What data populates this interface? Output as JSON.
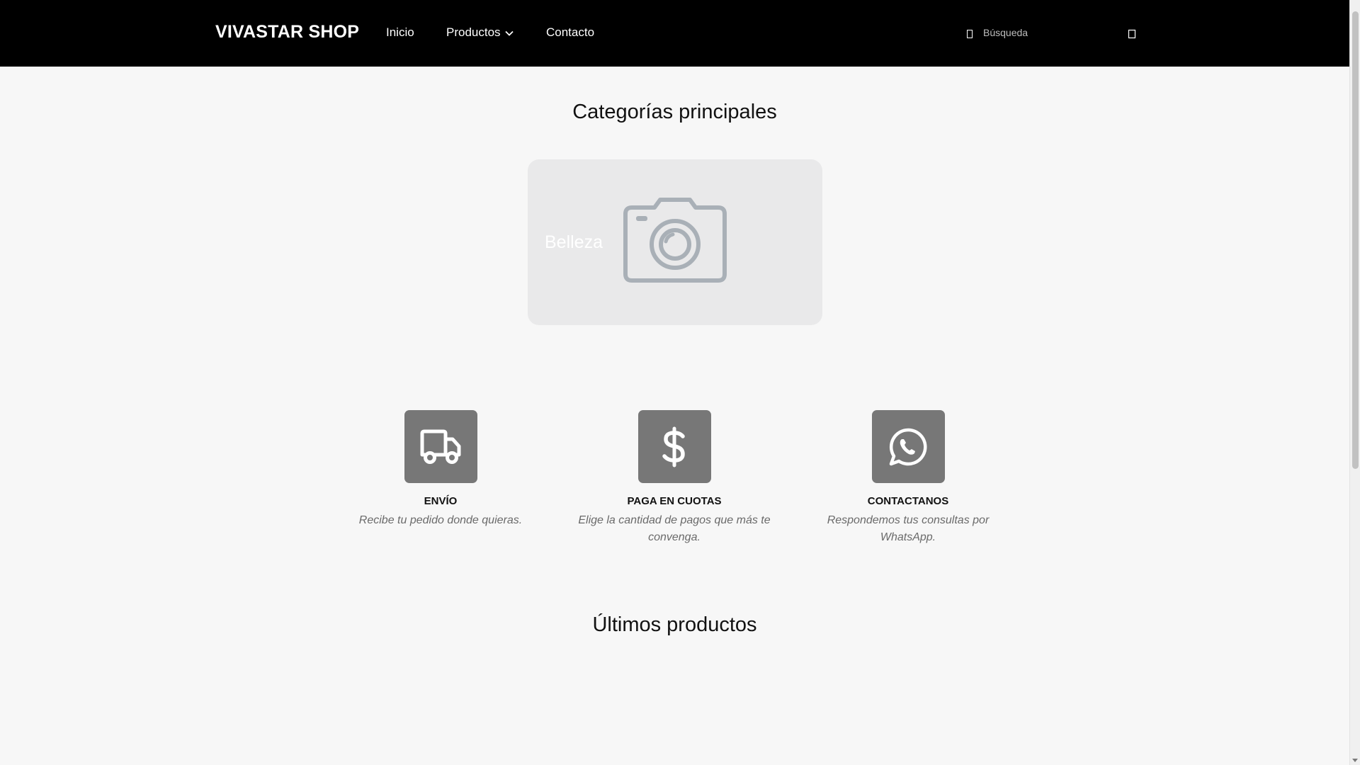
{
  "header": {
    "brand": "VIVASTAR SHOP",
    "nav": {
      "inicio": "Inicio",
      "productos": "Productos",
      "contacto": "Contacto"
    },
    "search": {
      "placeholder": "Búsqueda",
      "value": ""
    }
  },
  "categories": {
    "title": "Categorías principales",
    "items": [
      {
        "label": "Belleza",
        "icon": "camera-placeholder-icon"
      }
    ]
  },
  "features": [
    {
      "icon": "truck-icon",
      "title": "ENVÍO",
      "description": "Recibe tu pedido donde quieras."
    },
    {
      "icon": "dollar-icon",
      "title": "PAGA EN CUOTAS",
      "description": "Elige la cantidad de pagos que más te convenga."
    },
    {
      "icon": "whatsapp-icon",
      "title": "CONTACTANOS",
      "description": "Respondemos tus consultas por WhatsApp."
    }
  ],
  "latest": {
    "title": "Últimos productos"
  },
  "colors": {
    "header_bg": "#000000",
    "page_bg": "#f7f7f7",
    "card_bg": "#e9e9ea",
    "feature_icon_bg": "#777777",
    "description_text": "#6a6a6a"
  }
}
